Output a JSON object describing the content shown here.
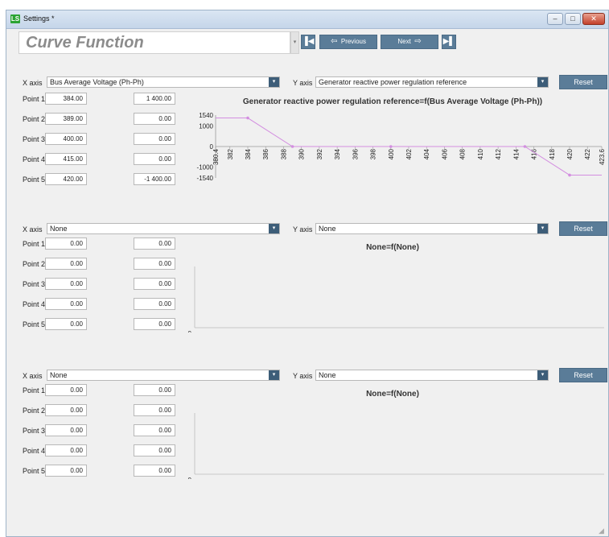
{
  "window": {
    "title": "Settings *",
    "app_icon": "LS",
    "minimize_icon": "minimize-icon",
    "maximize_icon": "maximize-icon",
    "close_icon": "close-icon",
    "minimize_glyph": "–",
    "maximize_glyph": "□",
    "close_glyph": "✕"
  },
  "form": {
    "title": "Curve Function",
    "dropdown_glyph": "▾",
    "first_glyph": "▐◀",
    "prev_glyph": "⇦",
    "previous_label": "Previous",
    "next_label": "Next",
    "next_glyph": "⇨",
    "last_glyph": "▶▌"
  },
  "labels": {
    "x_axis": "X axis",
    "y_axis": "Y axis",
    "reset": "Reset",
    "points": [
      "Point 1",
      "Point 2",
      "Point 3",
      "Point 4",
      "Point 5"
    ],
    "dropdown_glyph": "▾"
  },
  "curves": [
    {
      "x_axis": "Bus Average Voltage (Ph-Ph)",
      "y_axis": "Generator reactive power regulation reference",
      "x_values": [
        "384.00",
        "389.00",
        "400.00",
        "415.00",
        "420.00"
      ],
      "y_values": [
        "1 400.00",
        "0.00",
        "0.00",
        "0.00",
        "-1 400.00"
      ],
      "chart_title": "Generator reactive power regulation reference=f(Bus Average Voltage (Ph-Ph))"
    },
    {
      "x_axis": "None",
      "y_axis": "None",
      "x_values": [
        "0.00",
        "0.00",
        "0.00",
        "0.00",
        "0.00"
      ],
      "y_values": [
        "0.00",
        "0.00",
        "0.00",
        "0.00",
        "0.00"
      ],
      "chart_title": "None=f(None)"
    },
    {
      "x_axis": "None",
      "y_axis": "None",
      "x_values": [
        "0.00",
        "0.00",
        "0.00",
        "0.00",
        "0.00"
      ],
      "y_values": [
        "0.00",
        "0.00",
        "0.00",
        "0.00",
        "0.00"
      ],
      "chart_title": "None=f(None)"
    }
  ],
  "chart_data": [
    {
      "type": "line",
      "title": "Generator reactive power regulation reference=f(Bus Average Voltage (Ph-Ph))",
      "points": [
        [
          384,
          1400
        ],
        [
          389,
          0
        ],
        [
          400,
          0
        ],
        [
          415,
          0
        ],
        [
          420,
          -1400
        ]
      ],
      "extended_line": [
        [
          380.4,
          1400
        ],
        [
          384,
          1400
        ],
        [
          389,
          0
        ],
        [
          415,
          0
        ],
        [
          420,
          -1400
        ],
        [
          423.6,
          -1400
        ]
      ],
      "xlim": [
        380.4,
        423.6
      ],
      "ylim": [
        -1540,
        1540
      ],
      "x_ticks": [
        "380.4",
        "382",
        "384",
        "386",
        "388",
        "390",
        "392",
        "394",
        "396",
        "398",
        "400",
        "402",
        "404",
        "406",
        "408",
        "410",
        "412",
        "414",
        "416",
        "418",
        "420",
        "422",
        "423.6"
      ],
      "y_ticks": [
        "1540",
        "1000",
        "0",
        "-1000",
        "-1540"
      ],
      "color": "#d38ee0"
    },
    {
      "type": "line",
      "title": "None=f(None)",
      "points": [],
      "y_ticks": [
        "0"
      ]
    },
    {
      "type": "line",
      "title": "None=f(None)",
      "points": [],
      "y_ticks": [
        "0"
      ]
    }
  ]
}
